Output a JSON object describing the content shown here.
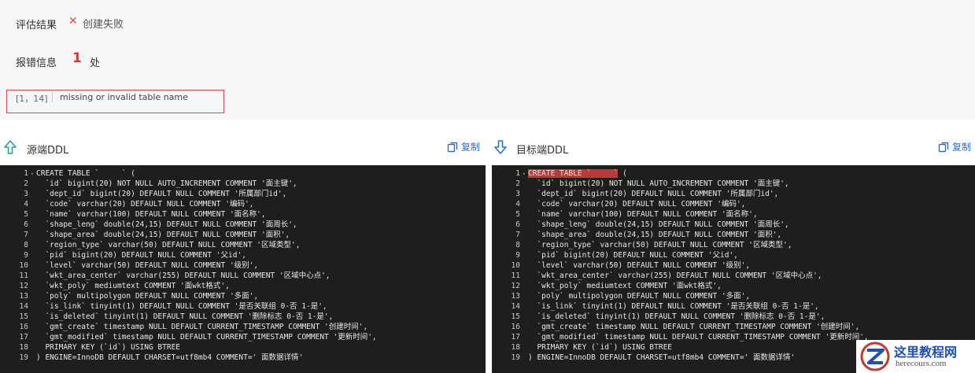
{
  "result": {
    "eval_label": "评估结果",
    "status_icon": "close-x-icon",
    "status_text": "创建失败",
    "err_label": "报错信息",
    "err_count": "1",
    "err_unit": "处",
    "error": {
      "position": "[1，14]",
      "message": "missing or invalid table name"
    }
  },
  "source": {
    "title": "源端DDL",
    "copy_label": "复制",
    "icon": "arrow-up-icon"
  },
  "target": {
    "title": "目标端DDL",
    "copy_label": "复制",
    "icon": "arrow-down-icon"
  },
  "colors": {
    "error_red": "#e5322d",
    "link_blue": "#2a6fd6",
    "editor_bg": "#1e1f1c",
    "error_highlight": "#b83a3a"
  },
  "code_lines": [
    "CREATE TABLE `     ` (",
    "  `id` bigint(20) NOT NULL AUTO_INCREMENT COMMENT '面主键',",
    "  `dept_id` bigint(20) DEFAULT NULL COMMENT '所属部门id',",
    "  `code` varchar(20) DEFAULT NULL COMMENT '编码',",
    "  `name` varchar(100) DEFAULT NULL COMMENT '面名称',",
    "  `shape_leng` double(24,15) DEFAULT NULL COMMENT '面周长',",
    "  `shape_area` double(24,15) DEFAULT NULL COMMENT '面积',",
    "  `region_type` varchar(50) DEFAULT NULL COMMENT '区域类型',",
    "  `pid` bigint(20) DEFAULT NULL COMMENT '父id',",
    "  `level` varchar(50) DEFAULT NULL COMMENT '级别',",
    "  `wkt_area_center` varchar(255) DEFAULT NULL COMMENT '区域中心点',",
    "  `wkt_poly` mediumtext COMMENT '面wkt格式',",
    "  `poly` multipolygon DEFAULT NULL COMMENT '多面',",
    "  `is_link` tinyint(1) DEFAULT NULL COMMENT '是否关联组 0-否 1-是',",
    "  `is_deleted` tinyint(1) DEFAULT NULL COMMENT '删除标志 0-否 1-是',",
    "  `gmt_create` timestamp NULL DEFAULT CURRENT_TIMESTAMP COMMENT '创建时间',",
    "  `gmt_modified` timestamp NULL DEFAULT CURRENT_TIMESTAMP COMMENT '更新时间',",
    "  PRIMARY KEY (`id`) USING BTREE",
    ") ENGINE=InnoDB DEFAULT CHARSET=utf8mb4 COMMENT=' 面数据详情'"
  ],
  "watermark": {
    "name": "这里教程网",
    "url": "herecours.com"
  }
}
